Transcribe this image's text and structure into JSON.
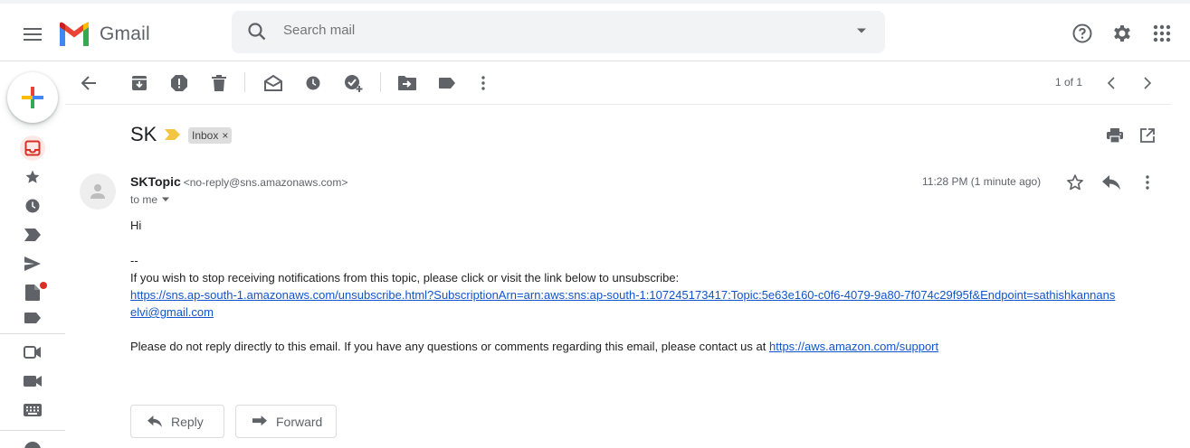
{
  "header": {
    "app_name": "Gmail",
    "search_placeholder": "Search mail"
  },
  "toolbar": {
    "pager": "1 of 1"
  },
  "message": {
    "subject": "SK",
    "label": "Inbox",
    "label_remove": "×",
    "sender_name": "SKTopic",
    "sender_email": "<no-reply@sns.amazonaws.com>",
    "to": "to me",
    "timestamp": "11:28 PM (1 minute ago)",
    "body": {
      "greeting": "Hi",
      "separator": "--",
      "unsubscribe_text": "If you wish to stop receiving notifications from this topic, please click or visit the link below to unsubscribe:",
      "unsubscribe_link_line1": "https://sns.ap-south-1.amazonaws.com/unsubscribe.html?SubscriptionArn=arn:aws:sns:ap-south-1:107245173417:Topic:5e63e160-c0f6-4079-9a80-7f074c29f95f&Endpoint=sathishkannans",
      "unsubscribe_link_line2": "elvi@gmail.com",
      "noreply_text": "Please do not reply directly to this email. If you have any questions or comments regarding this email, please contact us at ",
      "support_link": "https://aws.amazon.com/support"
    }
  },
  "actions": {
    "reply_label": "Reply",
    "forward_label": "Forward"
  },
  "colors": {
    "accent_red": "#d93025",
    "link_blue": "#1155cc",
    "importance_yellow": "#f4c542",
    "icon_gray": "#5f6368"
  }
}
